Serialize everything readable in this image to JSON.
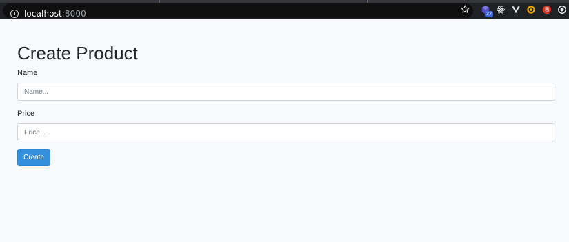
{
  "browser": {
    "url_host": "localhost",
    "url_port": ":8000",
    "extension_badge": "37",
    "icons": {
      "site_info": "info-icon",
      "bookmark": "star-icon",
      "extensions": [
        "hexagon-extension-icon",
        "react-devtools-icon",
        "vue-devtools-icon",
        "circle-extension-icon",
        "red-shield-extension-icon",
        "record-extension-icon"
      ]
    }
  },
  "form": {
    "title": "Create Product",
    "name_label": "Name",
    "name_placeholder": "Name...",
    "name_value": "",
    "price_label": "Price",
    "price_placeholder": "Price...",
    "price_value": "",
    "submit_label": "Create"
  },
  "colors": {
    "primary_button": "#3490dc",
    "page_background": "#f8f9fb",
    "chrome_background": "#202124"
  }
}
